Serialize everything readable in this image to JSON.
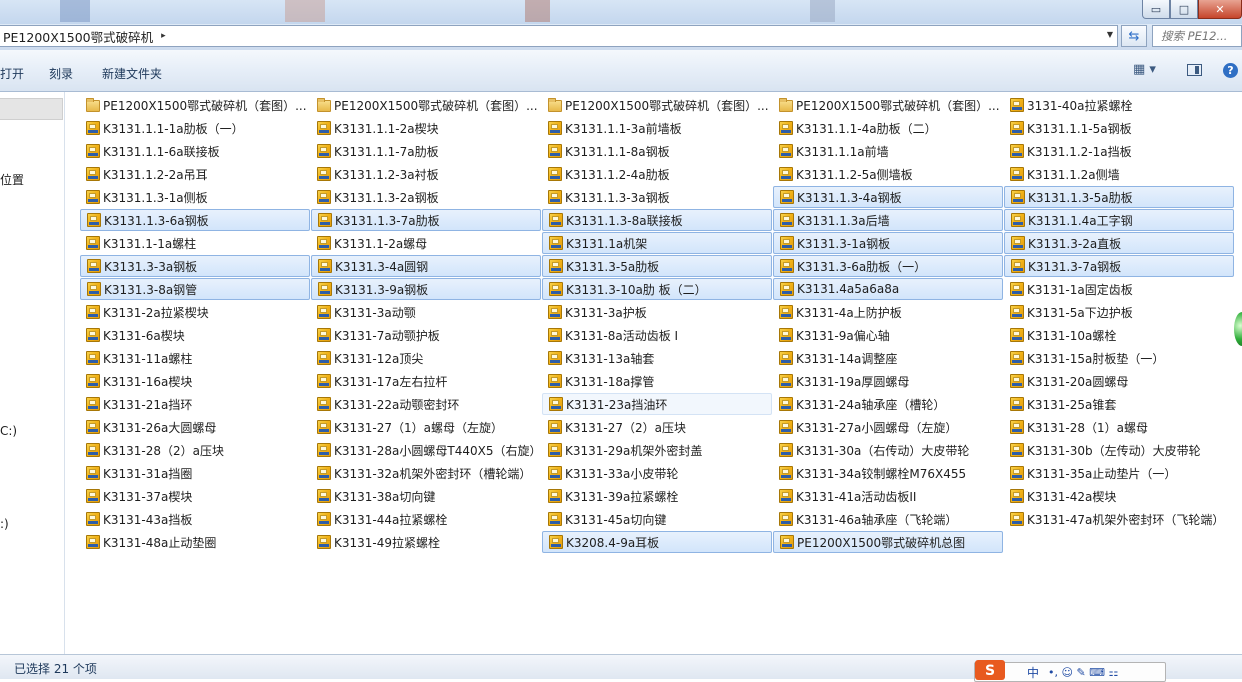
{
  "window": {
    "controls": {
      "minimize": "▭",
      "maximize": "□",
      "close": "✕"
    }
  },
  "address_bar": {
    "breadcrumb": "PE1200X1500鄂式破碎机",
    "crumb_arrow": "▸",
    "dropdown_arrow": "▼",
    "refresh_glyph": "⇆",
    "search_placeholder": "搜索 PE12..."
  },
  "toolbar": {
    "open_label": "打开",
    "burn_label": "刻录",
    "new_folder_label": "新建文件夹",
    "view_options_glyph": "▦ ▾",
    "help_glyph": "?"
  },
  "navigation": {
    "items": [
      "位置",
      "C:)",
      ":)"
    ]
  },
  "files": {
    "items": [
      {
        "name": "PE1200X1500鄂式破碎机（套图）...",
        "type": "folder",
        "state": "normal"
      },
      {
        "name": "PE1200X1500鄂式破碎机（套图）...",
        "type": "folder",
        "state": "normal"
      },
      {
        "name": "PE1200X1500鄂式破碎机（套图）...",
        "type": "folder",
        "state": "normal"
      },
      {
        "name": "PE1200X1500鄂式破碎机（套图）...",
        "type": "folder",
        "state": "normal"
      },
      {
        "name": "3131-40a拉紧螺栓",
        "type": "file",
        "state": "normal"
      },
      {
        "name": "K3131.1.1-1a肋板（一）",
        "type": "file",
        "state": "normal"
      },
      {
        "name": "K3131.1.1-2a楔块",
        "type": "file",
        "state": "normal"
      },
      {
        "name": "K3131.1.1-3a前墙板",
        "type": "file",
        "state": "normal"
      },
      {
        "name": "K3131.1.1-4a肋板（二）",
        "type": "file",
        "state": "normal"
      },
      {
        "name": "K3131.1.1-5a钢板",
        "type": "file",
        "state": "normal"
      },
      {
        "name": "K3131.1.1-6a联接板",
        "type": "file",
        "state": "normal"
      },
      {
        "name": "K3131.1.1-7a肋板",
        "type": "file",
        "state": "normal"
      },
      {
        "name": "K3131.1.1-8a钢板",
        "type": "file",
        "state": "normal"
      },
      {
        "name": "K3131.1.1a前墙",
        "type": "file",
        "state": "normal"
      },
      {
        "name": "K3131.1.2-1a挡板",
        "type": "file",
        "state": "normal"
      },
      {
        "name": "K3131.1.2-2a吊耳",
        "type": "file",
        "state": "normal"
      },
      {
        "name": "K3131.1.2-3a衬板",
        "type": "file",
        "state": "normal"
      },
      {
        "name": "K3131.1.2-4a肋板",
        "type": "file",
        "state": "normal"
      },
      {
        "name": "K3131.1.2-5a侧墙板",
        "type": "file",
        "state": "normal"
      },
      {
        "name": "K3131.1.2a侧墙",
        "type": "file",
        "state": "normal"
      },
      {
        "name": "K3131.1.3-1a侧板",
        "type": "file",
        "state": "normal"
      },
      {
        "name": "K3131.1.3-2a钢板",
        "type": "file",
        "state": "normal"
      },
      {
        "name": "K3131.1.3-3a钢板",
        "type": "file",
        "state": "normal"
      },
      {
        "name": "K3131.1.3-4a钢板",
        "type": "file",
        "state": "selected"
      },
      {
        "name": "K3131.1.3-5a肋板",
        "type": "file",
        "state": "selected"
      },
      {
        "name": "K3131.1.3-6a钢板",
        "type": "file",
        "state": "selected"
      },
      {
        "name": "K3131.1.3-7a肋板",
        "type": "file",
        "state": "selected"
      },
      {
        "name": "K3131.1.3-8a联接板",
        "type": "file",
        "state": "selected"
      },
      {
        "name": "K3131.1.3a后墙",
        "type": "file",
        "state": "selected"
      },
      {
        "name": "K3131.1.4a工字钢",
        "type": "file",
        "state": "selected"
      },
      {
        "name": "K3131.1-1a螺柱",
        "type": "file",
        "state": "normal"
      },
      {
        "name": "K3131.1-2a螺母",
        "type": "file",
        "state": "normal"
      },
      {
        "name": "K3131.1a机架",
        "type": "file",
        "state": "selected"
      },
      {
        "name": "K3131.3-1a钢板",
        "type": "file",
        "state": "selected"
      },
      {
        "name": "K3131.3-2a直板",
        "type": "file",
        "state": "selected"
      },
      {
        "name": "K3131.3-3a钢板",
        "type": "file",
        "state": "selected"
      },
      {
        "name": "K3131.3-4a圆钢",
        "type": "file",
        "state": "selected"
      },
      {
        "name": "K3131.3-5a肋板",
        "type": "file",
        "state": "selected"
      },
      {
        "name": "K3131.3-6a肋板（一）",
        "type": "file",
        "state": "selected"
      },
      {
        "name": "K3131.3-7a钢板",
        "type": "file",
        "state": "selected"
      },
      {
        "name": "K3131.3-8a钢管",
        "type": "file",
        "state": "selected"
      },
      {
        "name": "K3131.3-9a钢板",
        "type": "file",
        "state": "selected"
      },
      {
        "name": "K3131.3-10a肋 板（二）",
        "type": "file",
        "state": "selected"
      },
      {
        "name": "K3131.4a5a6a8a",
        "type": "file",
        "state": "selected"
      },
      {
        "name": "K3131-1a固定齿板",
        "type": "file",
        "state": "normal"
      },
      {
        "name": "K3131-2a拉紧楔块",
        "type": "file",
        "state": "normal"
      },
      {
        "name": "K3131-3a动颚",
        "type": "file",
        "state": "normal"
      },
      {
        "name": "K3131-3a护板",
        "type": "file",
        "state": "normal"
      },
      {
        "name": "K3131-4a上防护板",
        "type": "file",
        "state": "normal"
      },
      {
        "name": "K3131-5a下边护板",
        "type": "file",
        "state": "normal"
      },
      {
        "name": "K3131-6a楔块",
        "type": "file",
        "state": "normal"
      },
      {
        "name": "K3131-7a动颚护板",
        "type": "file",
        "state": "normal"
      },
      {
        "name": "K3131-8a活动齿板 I",
        "type": "file",
        "state": "normal"
      },
      {
        "name": "K3131-9a偏心轴",
        "type": "file",
        "state": "normal"
      },
      {
        "name": "K3131-10a螺栓",
        "type": "file",
        "state": "normal"
      },
      {
        "name": "K3131-11a螺柱",
        "type": "file",
        "state": "normal"
      },
      {
        "name": "K3131-12a顶尖",
        "type": "file",
        "state": "normal"
      },
      {
        "name": "K3131-13a轴套",
        "type": "file",
        "state": "normal"
      },
      {
        "name": "K3131-14a调整座",
        "type": "file",
        "state": "normal"
      },
      {
        "name": "K3131-15a肘板垫（一）",
        "type": "file",
        "state": "normal"
      },
      {
        "name": "K3131-16a楔块",
        "type": "file",
        "state": "normal"
      },
      {
        "name": "K3131-17a左右拉杆",
        "type": "file",
        "state": "normal"
      },
      {
        "name": "K3131-18a撑管",
        "type": "file",
        "state": "normal"
      },
      {
        "name": "K3131-19a厚圆螺母",
        "type": "file",
        "state": "normal"
      },
      {
        "name": "K3131-20a圆螺母",
        "type": "file",
        "state": "normal"
      },
      {
        "name": "K3131-21a挡环",
        "type": "file",
        "state": "normal"
      },
      {
        "name": "K3131-22a动颚密封环",
        "type": "file",
        "state": "normal"
      },
      {
        "name": "K3131-23a挡油环",
        "type": "file",
        "state": "hover"
      },
      {
        "name": "K3131-24a轴承座（槽轮）",
        "type": "file",
        "state": "normal"
      },
      {
        "name": "K3131-25a锥套",
        "type": "file",
        "state": "normal"
      },
      {
        "name": "K3131-26a大圆螺母",
        "type": "file",
        "state": "normal"
      },
      {
        "name": "K3131-27（1）a螺母（左旋）",
        "type": "file",
        "state": "normal"
      },
      {
        "name": "K3131-27（2）a压块",
        "type": "file",
        "state": "normal"
      },
      {
        "name": "K3131-27a小圆螺母（左旋）",
        "type": "file",
        "state": "normal"
      },
      {
        "name": "K3131-28（1）a螺母",
        "type": "file",
        "state": "normal"
      },
      {
        "name": "K3131-28（2）a压块",
        "type": "file",
        "state": "normal"
      },
      {
        "name": "K3131-28a小圆螺母T440X5（右旋）",
        "type": "file",
        "state": "normal"
      },
      {
        "name": "K3131-29a机架外密封盖",
        "type": "file",
        "state": "normal"
      },
      {
        "name": "K3131-30a（右传动）大皮带轮",
        "type": "file",
        "state": "normal"
      },
      {
        "name": "K3131-30b（左传动）大皮带轮",
        "type": "file",
        "state": "normal"
      },
      {
        "name": "K3131-31a挡圈",
        "type": "file",
        "state": "normal"
      },
      {
        "name": "K3131-32a机架外密封环（槽轮端）",
        "type": "file",
        "state": "normal"
      },
      {
        "name": "K3131-33a小皮带轮",
        "type": "file",
        "state": "normal"
      },
      {
        "name": "K3131-34a铰制螺栓M76X455",
        "type": "file",
        "state": "normal"
      },
      {
        "name": "K3131-35a止动垫片（一）",
        "type": "file",
        "state": "normal"
      },
      {
        "name": "K3131-37a楔块",
        "type": "file",
        "state": "normal"
      },
      {
        "name": "K3131-38a切向键",
        "type": "file",
        "state": "normal"
      },
      {
        "name": "K3131-39a拉紧螺栓",
        "type": "file",
        "state": "normal"
      },
      {
        "name": "K3131-41a活动齿板II",
        "type": "file",
        "state": "normal"
      },
      {
        "name": "K3131-42a楔块",
        "type": "file",
        "state": "normal"
      },
      {
        "name": "K3131-43a挡板",
        "type": "file",
        "state": "normal"
      },
      {
        "name": "K3131-44a拉紧螺栓",
        "type": "file",
        "state": "normal"
      },
      {
        "name": "K3131-45a切向键",
        "type": "file",
        "state": "normal"
      },
      {
        "name": "K3131-46a轴承座（飞轮端）",
        "type": "file",
        "state": "normal"
      },
      {
        "name": "K3131-47a机架外密封环（飞轮端）",
        "type": "file",
        "state": "normal"
      },
      {
        "name": "K3131-48a止动垫圈",
        "type": "file",
        "state": "normal"
      },
      {
        "name": "K3131-49拉紧螺栓",
        "type": "file",
        "state": "normal"
      },
      {
        "name": "K3208.4-9a耳板",
        "type": "file",
        "state": "selected"
      },
      {
        "name": "PE1200X1500鄂式破碎机总图",
        "type": "file",
        "state": "selected"
      }
    ]
  },
  "status_bar": {
    "selection_text": "已选择 21 个项",
    "ime": {
      "logo": "S",
      "mode": "中",
      "icons": "•, ☺ ✎ ⌨ ⚏"
    }
  }
}
